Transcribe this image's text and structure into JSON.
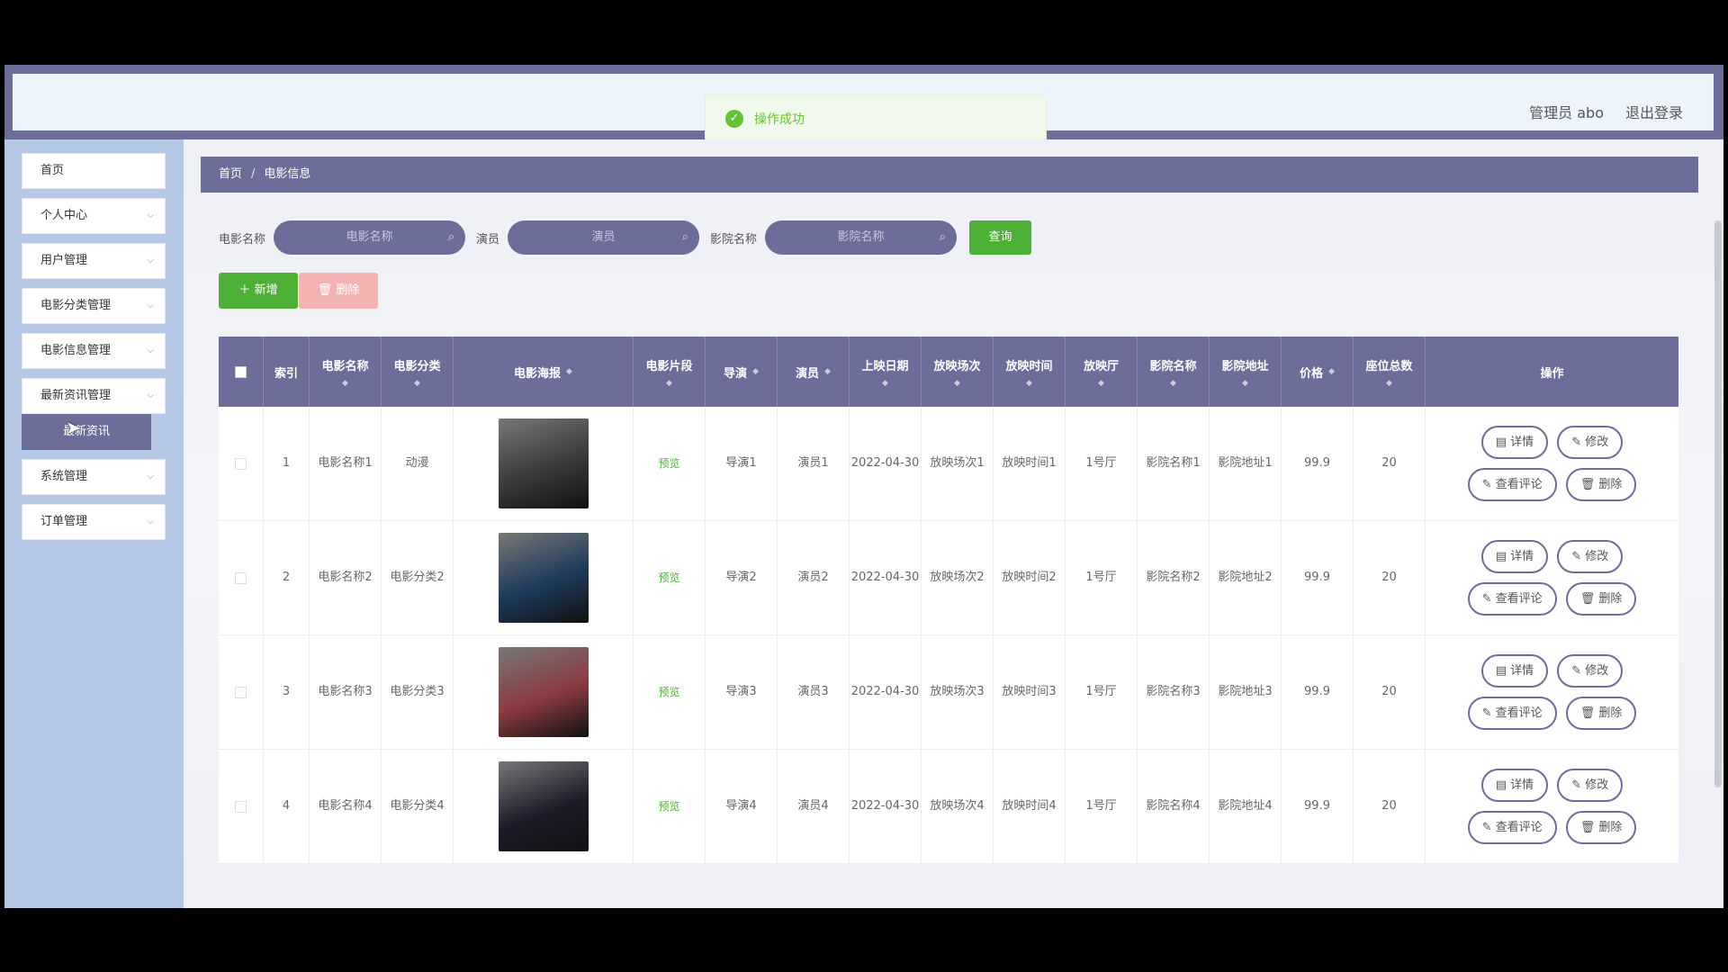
{
  "toast": {
    "message": "操作成功"
  },
  "user": {
    "name": "管理员 abo",
    "logout": "退出登录"
  },
  "sidebar": {
    "items": [
      {
        "label": "首页",
        "expandable": false
      },
      {
        "label": "个人中心",
        "expandable": true
      },
      {
        "label": "用户管理",
        "expandable": true
      },
      {
        "label": "电影分类管理",
        "expandable": true
      },
      {
        "label": "电影信息管理",
        "expandable": true
      },
      {
        "label": "最新资讯管理",
        "expandable": true
      },
      {
        "label": "系统管理",
        "expandable": true
      },
      {
        "label": "订单管理",
        "expandable": true
      }
    ],
    "sub_item": "最新资讯"
  },
  "breadcrumb": {
    "home": "首页",
    "current": "电影信息"
  },
  "search": {
    "fields": [
      {
        "label": "电影名称",
        "placeholder": "电影名称"
      },
      {
        "label": "演员",
        "placeholder": "演员"
      },
      {
        "label": "影院名称",
        "placeholder": "影院名称"
      }
    ],
    "query_label": "查询"
  },
  "actions": {
    "add_label": "新增",
    "delete_label": "删除"
  },
  "table": {
    "headers": [
      "索引",
      "电影名称",
      "电影分类",
      "电影海报",
      "电影片段",
      "导演",
      "演员",
      "上映日期",
      "放映场次",
      "放映时间",
      "放映厅",
      "影院名称",
      "影院地址",
      "价格",
      "座位总数",
      "操作"
    ],
    "preview_label": "预览",
    "op_labels": {
      "detail": "详情",
      "edit": "修改",
      "comments": "查看评论",
      "delete": "删除"
    },
    "rows": [
      {
        "index": "1",
        "name": "电影名称1",
        "category": "动漫",
        "director": "导演1",
        "actor": "演员1",
        "date": "2022-04-30",
        "session": "放映场次1",
        "time": "放映时间1",
        "hall": "1号厅",
        "cinema": "影院名称1",
        "address": "影院地址1",
        "price": "99.9",
        "seats": "20",
        "poster_color": "#3a3a3a"
      },
      {
        "index": "2",
        "name": "电影名称2",
        "category": "电影分类2",
        "director": "导演2",
        "actor": "演员2",
        "date": "2022-04-30",
        "session": "放映场次2",
        "time": "放映时间2",
        "hall": "1号厅",
        "cinema": "影院名称2",
        "address": "影院地址2",
        "price": "99.9",
        "seats": "20",
        "poster_color": "#1d3a5a"
      },
      {
        "index": "3",
        "name": "电影名称3",
        "category": "电影分类3",
        "director": "导演3",
        "actor": "演员3",
        "date": "2022-04-30",
        "session": "放映场次3",
        "time": "放映时间3",
        "hall": "1号厅",
        "cinema": "影院名称3",
        "address": "影院地址3",
        "price": "99.9",
        "seats": "20",
        "poster_color": "#8a3a3e"
      },
      {
        "index": "4",
        "name": "电影名称4",
        "category": "电影分类4",
        "director": "导演4",
        "actor": "演员4",
        "date": "2022-04-30",
        "session": "放映场次4",
        "time": "放映时间4",
        "hall": "1号厅",
        "cinema": "影院名称4",
        "address": "影院地址4",
        "price": "99.9",
        "seats": "20",
        "poster_color": "#1c1c2a"
      }
    ]
  }
}
